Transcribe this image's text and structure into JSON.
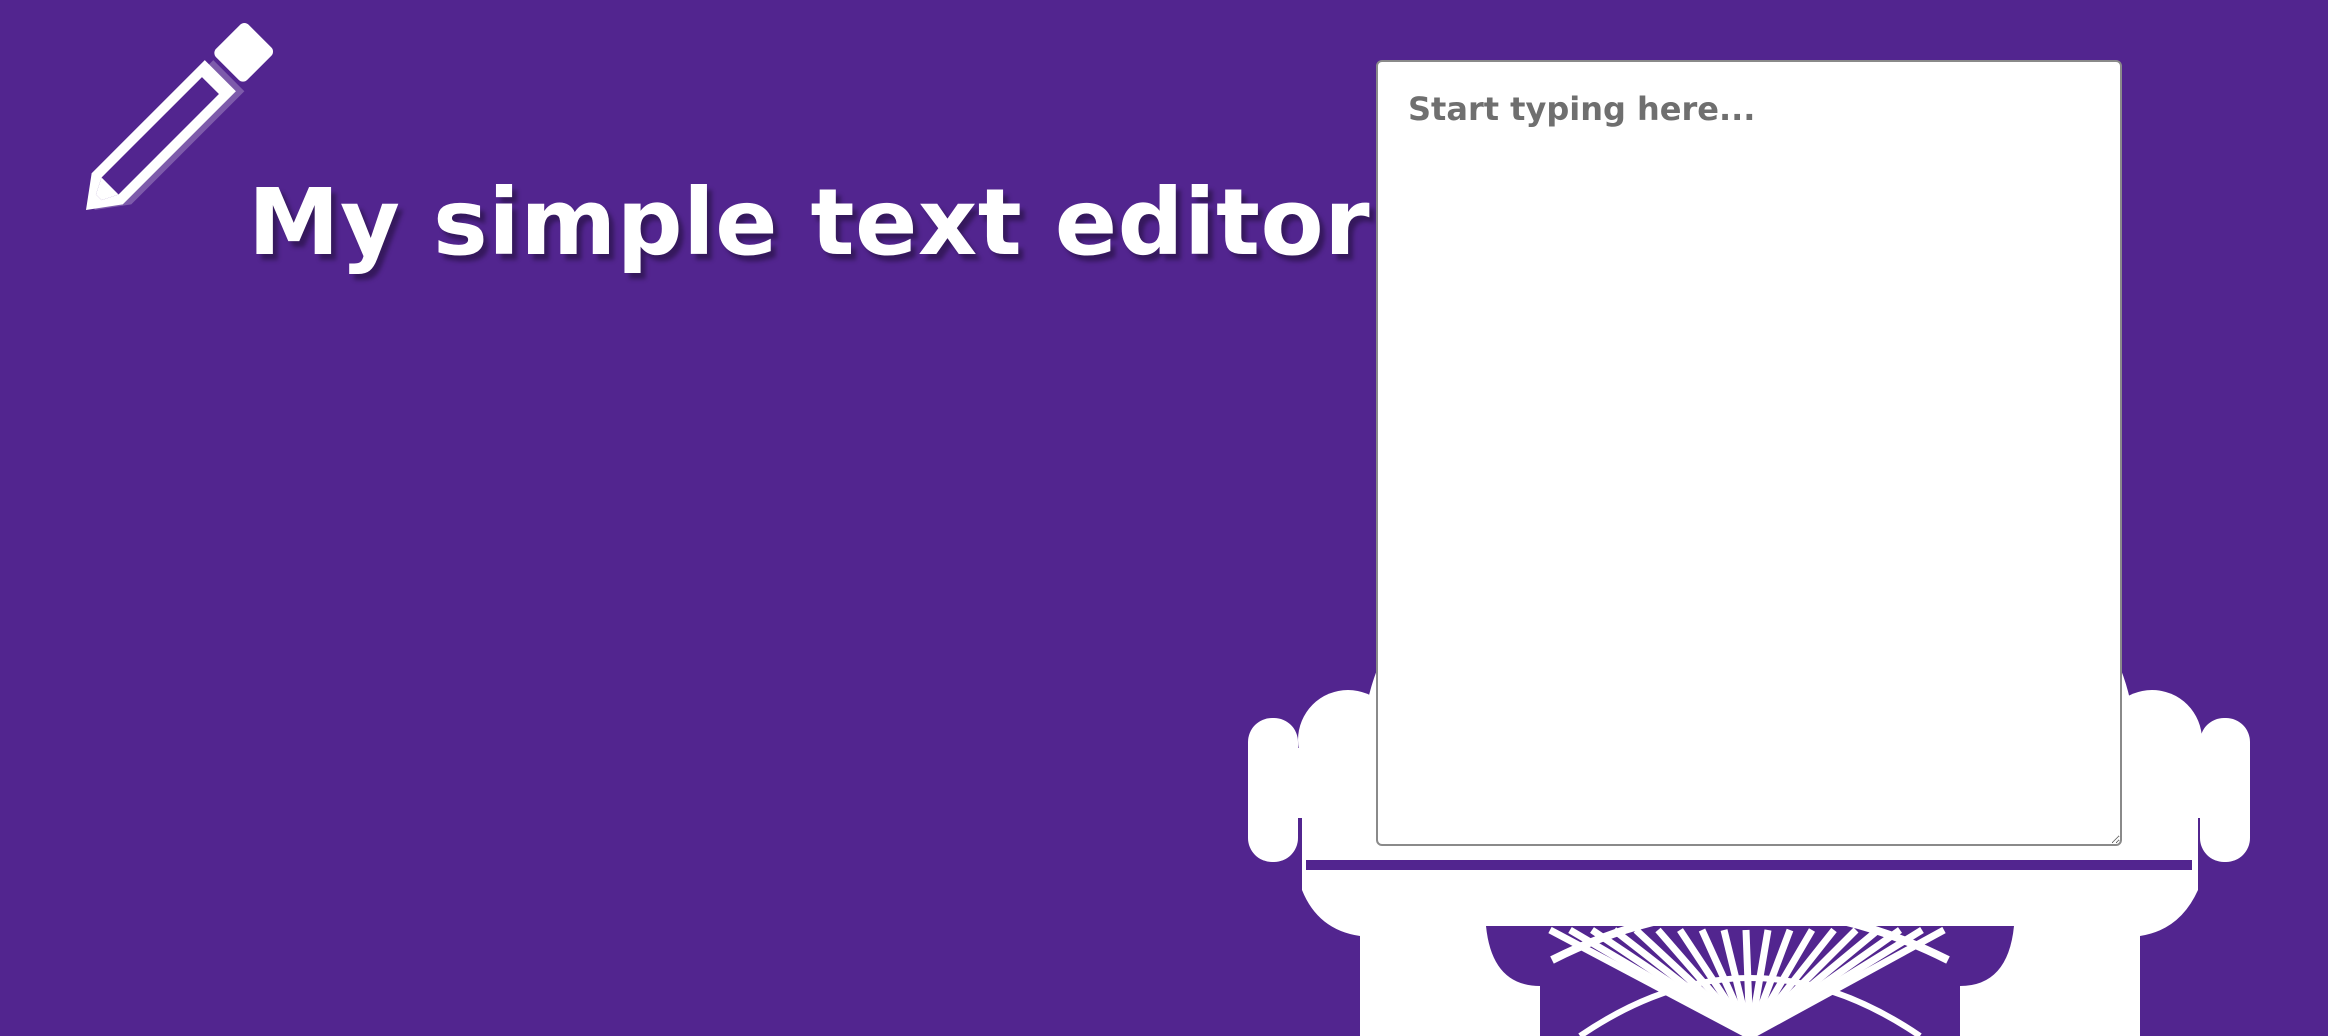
{
  "header": {
    "title": "My simple text editor",
    "icon": "pencil-icon"
  },
  "editor": {
    "placeholder": "Start typing here...",
    "value": ""
  },
  "decoration": {
    "illustration": "typewriter-illustration"
  },
  "colors": {
    "background": "#52258f",
    "foreground": "#ffffff",
    "placeholder": "#6f6f6f"
  }
}
